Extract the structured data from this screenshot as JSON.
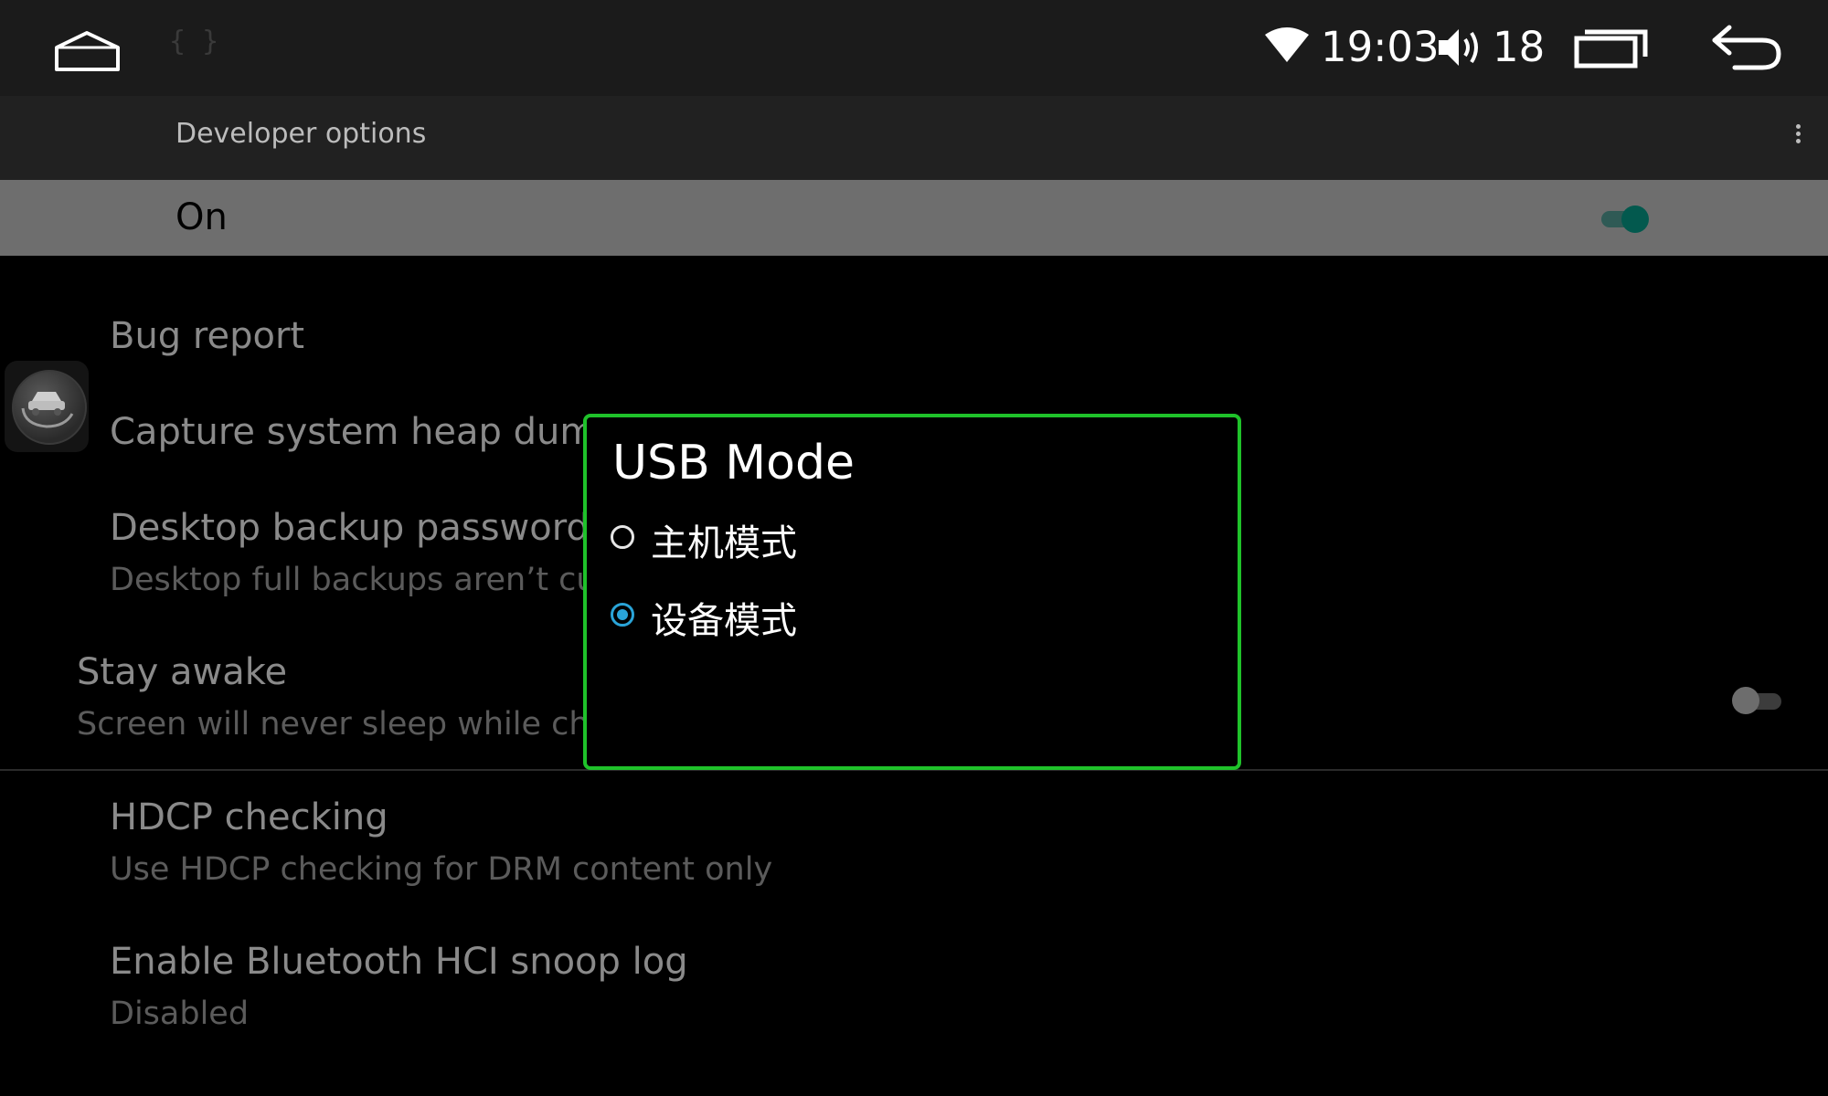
{
  "status_bar": {
    "time": "19:03",
    "volume_level": "18",
    "notification_glyph": "{ }",
    "icons": [
      "home-icon",
      "wifi-icon",
      "volume-icon",
      "recents-icon",
      "back-icon"
    ]
  },
  "action_bar": {
    "title": "Developer options",
    "menu_icon": "overflow-menu-icon"
  },
  "master_switch": {
    "label": "On",
    "checked": true,
    "accent_color": "#03594e"
  },
  "settings": {
    "bug_report": {
      "title": "Bug report"
    },
    "heap_dump": {
      "title": "Capture system heap dump"
    },
    "backup_password": {
      "title": "Desktop backup password",
      "summary": "Desktop full backups aren’t cur"
    },
    "stay_awake": {
      "title": "Stay awake",
      "summary": "Screen will never sleep while cha",
      "checked": false
    },
    "hdcp": {
      "title": "HDCP checking",
      "summary": "Use HDCP checking for DRM content only"
    },
    "bt_hci": {
      "title": "Enable Bluetooth HCI snoop log",
      "summary": "Disabled"
    }
  },
  "dialog": {
    "title": "USB Mode",
    "options": [
      {
        "label": "主机模式",
        "selected": false
      },
      {
        "label": "设备模式",
        "selected": true
      }
    ],
    "border_color": "#1fc22a",
    "radio_accent": "#2aa4d8"
  }
}
